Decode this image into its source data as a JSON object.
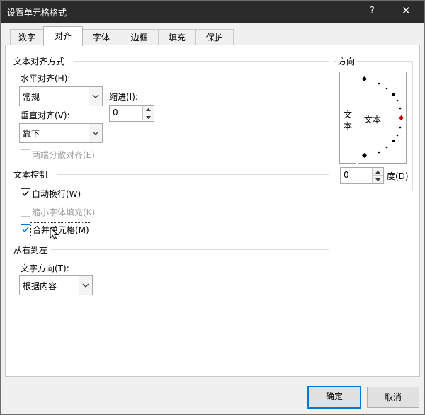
{
  "window": {
    "title": "设置单元格格式",
    "help": "?",
    "close": "✕"
  },
  "tabs": [
    "数字",
    "对齐",
    "字体",
    "边框",
    "填充",
    "保护"
  ],
  "text_align": {
    "group": "文本对齐方式",
    "horizontal_label": "水平对齐(H):",
    "horizontal_value": "常规",
    "indent_label": "缩进(I):",
    "indent_value": "0",
    "vertical_label": "垂直对齐(V):",
    "vertical_value": "靠下",
    "justify_distributed": "两端分散对齐(E)"
  },
  "text_control": {
    "group": "文本控制",
    "wrap": "自动换行(W)",
    "shrink": "缩小字体填充(K)",
    "merge": "合并单元格(M)"
  },
  "rtl": {
    "group": "从右到左",
    "direction_label": "文字方向(T):",
    "direction_value": "根据内容"
  },
  "orientation": {
    "group": "方向",
    "vertical_text": [
      "文",
      "本"
    ],
    "dial_text": "文本",
    "degree_value": "0",
    "degree_label": "度(D)"
  },
  "buttons": {
    "ok": "确定",
    "cancel": "取消"
  },
  "state": {
    "wrap_checked": true,
    "merge_checked": true,
    "shrink_enabled": false,
    "justify_enabled": false
  },
  "colors": {
    "titlebar": "#2b2b2b",
    "accent": "#0078d7",
    "dial_marker": "#c00000"
  }
}
